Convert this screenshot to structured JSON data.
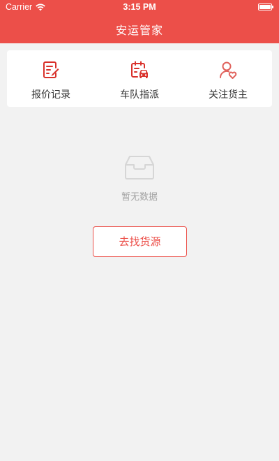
{
  "status_bar": {
    "carrier": "Carrier",
    "time": "3:15 PM",
    "icons": [
      "wifi-icon",
      "battery-icon"
    ]
  },
  "nav": {
    "title": "安运管家",
    "background_color": "#ec4f49"
  },
  "quick_actions": [
    {
      "label": "报价记录",
      "icon": "quote-record-icon"
    },
    {
      "label": "车队指派",
      "icon": "fleet-dispatch-icon"
    },
    {
      "label": "关注货主",
      "icon": "follow-shipper-icon"
    }
  ],
  "empty_state": {
    "icon": "empty-inbox-icon",
    "text": "暂无数据"
  },
  "find_button": {
    "label": "去找货源"
  },
  "colors": {
    "accent": "#ec4f49",
    "background": "#f2f2f2",
    "muted_text": "#a3a3a3"
  }
}
